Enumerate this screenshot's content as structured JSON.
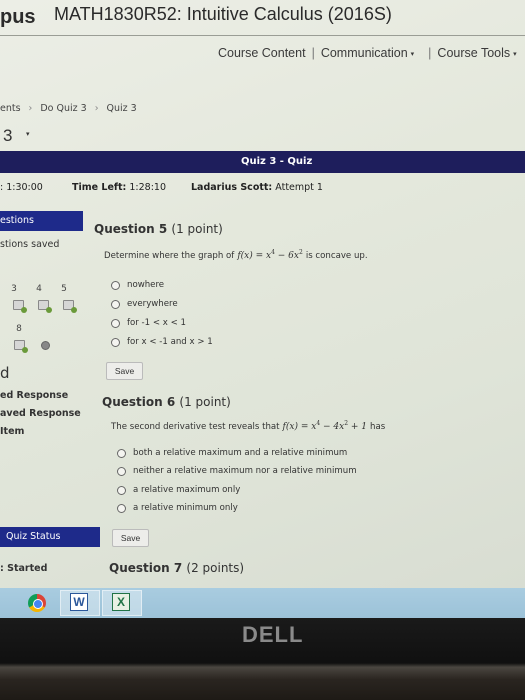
{
  "header": {
    "logo_fragment": "pus",
    "course_title": "MATH1830R52: Intuitive Calculus (2016S)"
  },
  "nav": {
    "items": [
      {
        "label": "Course Content",
        "has_dropdown": false
      },
      {
        "label": "Communication",
        "has_dropdown": true
      },
      {
        "label": "Course Tools",
        "has_dropdown": true
      }
    ],
    "separator": "|",
    "caret": "▾"
  },
  "breadcrumb": {
    "items": [
      "ents",
      "Do Quiz 3",
      "Quiz 3"
    ],
    "chevron": "›"
  },
  "page_heading": {
    "text": "3",
    "caret": "▾"
  },
  "quiz_bar": {
    "title": "Quiz 3 - Quiz"
  },
  "info_row": {
    "time_limit_fragment": ": 1:30:00",
    "time_left_label": "Time Left:",
    "time_left_value": "1:28:10",
    "student_name": "Ladarius Scott:",
    "attempt": "Attempt 1"
  },
  "sidebar": {
    "questions_header": "estions",
    "questions_saved": "stions saved",
    "question_numbers": [
      "3",
      "4",
      "5",
      "8"
    ],
    "legend_heading": "d",
    "legend": [
      "ed Response",
      "aved Response",
      "Item"
    ],
    "legend_item_bullet": "›",
    "quiz_status_header": "Quiz Status",
    "status_value": ": Started"
  },
  "questions": [
    {
      "title": "Question 5",
      "points": "(1 point)",
      "text_before": "Determine where the graph of",
      "math": {
        "lhs": "f(x) = x",
        "exp1": "4",
        "mid": " − 6x",
        "exp2": "2",
        "tail": ""
      },
      "text_after": "is concave up.",
      "options": [
        "nowhere",
        "everywhere",
        "for -1 < x < 1",
        "for x < -1 and x > 1"
      ],
      "save_label": "Save"
    },
    {
      "title": "Question 6",
      "points": "(1 point)",
      "text_before": "The second derivative test reveals that",
      "math": {
        "lhs": "f(x) = x",
        "exp1": "4",
        "mid": " − 4x",
        "exp2": "2",
        "tail": " + 1"
      },
      "text_after": "has",
      "options": [
        "both a relative maximum and a relative minimum",
        "neither a relative maximum nor a relative minimum",
        "a relative maximum only",
        "a relative minimum only"
      ],
      "save_label": "Save"
    },
    {
      "title": "Question 7",
      "points": "(2 points)"
    }
  ],
  "taskbar": {
    "apps": [
      {
        "name": "Chrome",
        "glyph": ""
      },
      {
        "name": "Word",
        "glyph": "W"
      },
      {
        "name": "Excel",
        "glyph": "X"
      }
    ]
  },
  "monitor": {
    "brand": "DELL"
  }
}
